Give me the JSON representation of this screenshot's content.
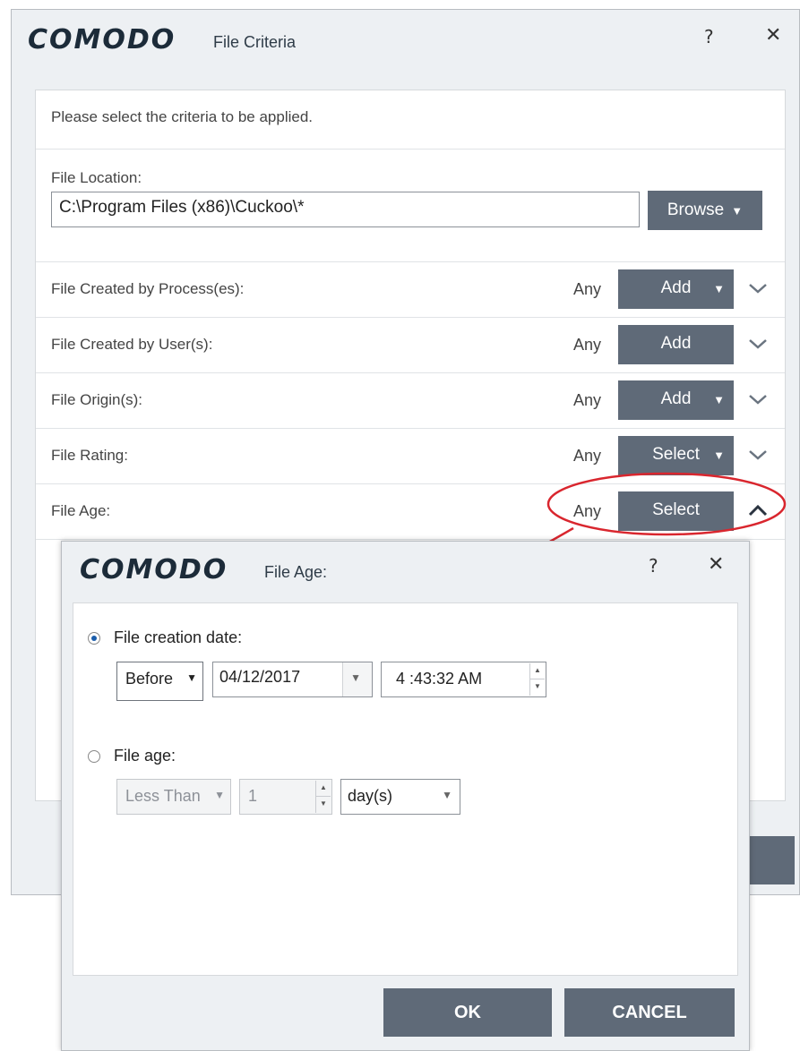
{
  "main": {
    "logo": "COMODO",
    "subtitle": "File Criteria",
    "help": "?",
    "close": "✕",
    "instruction": "Please select the criteria to be applied.",
    "location": {
      "label": "File Location:",
      "value": "C:\\Program Files (x86)\\Cuckoo\\*",
      "browse_label": "Browse"
    },
    "rows": [
      {
        "label": "File Created by Process(es):",
        "any": "Any",
        "button": "Add",
        "dropdown": true,
        "expanded": false
      },
      {
        "label": "File Created by User(s):",
        "any": "Any",
        "button": "Add",
        "dropdown": false,
        "expanded": false
      },
      {
        "label": "File Origin(s):",
        "any": "Any",
        "button": "Add",
        "dropdown": true,
        "expanded": false
      },
      {
        "label": "File Rating:",
        "any": "Any",
        "button": "Select",
        "dropdown": true,
        "expanded": false
      },
      {
        "label": "File Age:",
        "any": "Any",
        "button": "Select",
        "dropdown": false,
        "expanded": true
      }
    ]
  },
  "dialog": {
    "logo": "COMODO",
    "subtitle": "File Age:",
    "help": "?",
    "close": "✕",
    "creation": {
      "label": "File creation date:",
      "selected": true,
      "comparator": "Before",
      "date": "04/12/2017",
      "time": "4 :43:32  AM"
    },
    "age": {
      "label": "File age:",
      "selected": false,
      "comparator": "Less Than",
      "quantity": "1",
      "unit": "day(s)"
    },
    "ok_label": "OK",
    "cancel_label": "CANCEL"
  },
  "colors": {
    "button_bg": "#5f6a78",
    "window_bg": "#edf0f3",
    "callout": "#d9262e"
  }
}
